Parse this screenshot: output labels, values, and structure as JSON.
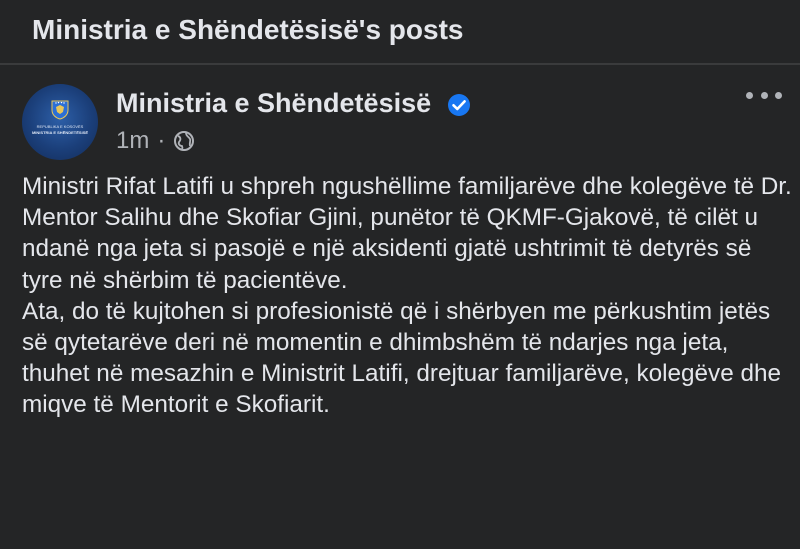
{
  "header": {
    "title": "Ministria e Shëndetësisë's posts"
  },
  "post": {
    "author": "Ministria e Shëndetësisë",
    "verified": true,
    "time": "1m",
    "separator": "·",
    "audience_icon": "globe-icon",
    "avatar_text": [
      "REPUBLIKA E KOSOVËS",
      "MINISTRIA E SHËNDETËSISË"
    ],
    "paragraphs": [
      "Ministri Rifat Latifi u shpreh ngushëllime familjarëve dhe kolegëve të Dr. Mentor Salihu dhe Skofiar Gjini, punëtor të QKMF-Gjakovë, të cilët u ndanë nga jeta si pasojë e një aksidenti gjatë ushtrimit të detyrës së tyre në shërbim të pacientëve.",
      "Ata, do të kujtohen si profesionistë që i shërbyen me përkushtim jetës së qytetarëve deri në momentin e dhimbshëm të ndarjes nga jeta, thuhet në mesazhin e Ministrit Latifi, drejtuar familjarëve, kolegëve dhe miqve të Mentorit e Skofiarit."
    ]
  },
  "colors": {
    "background": "#242526",
    "primary_text": "#e4e6eb",
    "secondary_text": "#b0b3b8",
    "verified_badge": "#1877f2"
  }
}
